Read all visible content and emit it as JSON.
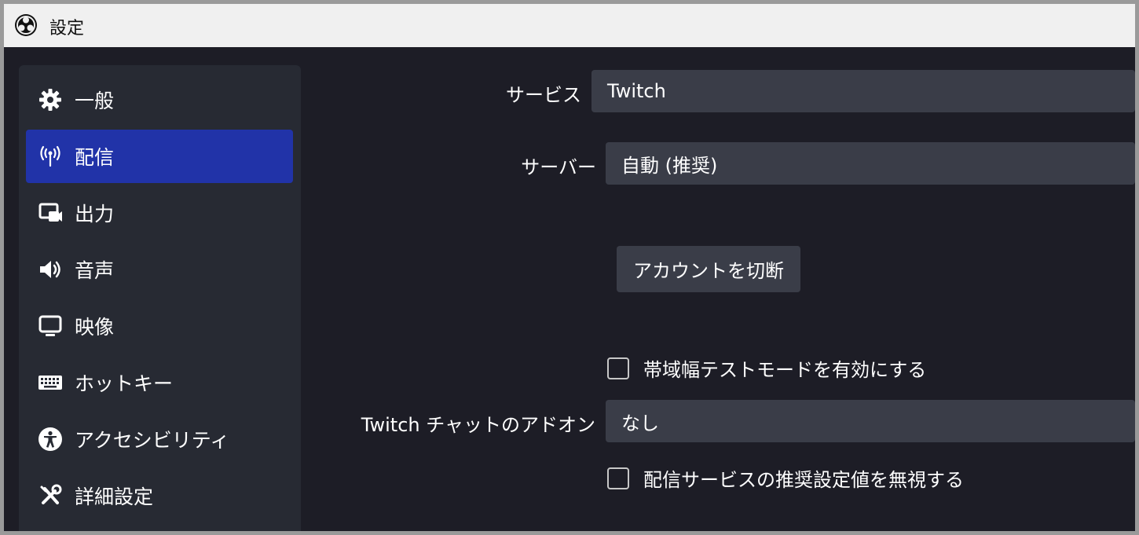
{
  "window": {
    "title": "設定"
  },
  "sidebar": {
    "items": [
      {
        "label": "一般",
        "icon": "gear-icon",
        "active": false
      },
      {
        "label": "配信",
        "icon": "broadcast-icon",
        "active": true
      },
      {
        "label": "出力",
        "icon": "output-icon",
        "active": false
      },
      {
        "label": "音声",
        "icon": "speaker-icon",
        "active": false
      },
      {
        "label": "映像",
        "icon": "monitor-icon",
        "active": false
      },
      {
        "label": "ホットキー",
        "icon": "keyboard-icon",
        "active": false
      },
      {
        "label": "アクセシビリティ",
        "icon": "accessibility-icon",
        "active": false
      },
      {
        "label": "詳細設定",
        "icon": "tools-icon",
        "active": false
      }
    ]
  },
  "stream": {
    "service_label": "サービス",
    "service_value": "Twitch",
    "server_label": "サーバー",
    "server_value": "自動 (推奨)",
    "disconnect_button": "アカウントを切断",
    "bandwidth_test_label": "帯域幅テストモードを有効にする",
    "bandwidth_test_checked": false,
    "chat_addon_label": "Twitch チャットのアドオン",
    "chat_addon_value": "なし",
    "ignore_recommended_label": "配信サービスの推奨設定値を無視する",
    "ignore_recommended_checked": false
  },
  "colors": {
    "window_bg": "#1d1d26",
    "sidebar_bg": "#272a33",
    "active_item": "#2133a8",
    "control_bg": "#3a3d48"
  }
}
